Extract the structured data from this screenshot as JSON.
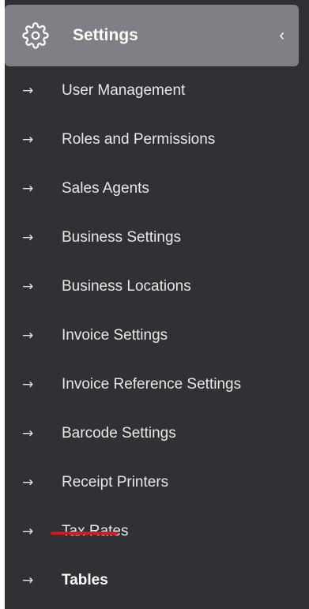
{
  "header": {
    "title": "Settings",
    "icon": "gear-icon",
    "chevron_icon": "chevron-left-icon",
    "chevron": "‹"
  },
  "menu": {
    "arrow": "→",
    "items": [
      {
        "label": "User Management"
      },
      {
        "label": "Roles and Permissions"
      },
      {
        "label": "Sales Agents"
      },
      {
        "label": "Business Settings"
      },
      {
        "label": "Business Locations"
      },
      {
        "label": "Invoice Settings"
      },
      {
        "label": "Invoice Reference Settings"
      },
      {
        "label": "Barcode Settings"
      },
      {
        "label": "Receipt Printers"
      },
      {
        "label": "Tax Rates"
      },
      {
        "label": "Tables"
      }
    ],
    "active_index": 10
  },
  "colors": {
    "panel": "#2f3135",
    "header": "#7e8085",
    "active_underline": "#d6171e"
  }
}
